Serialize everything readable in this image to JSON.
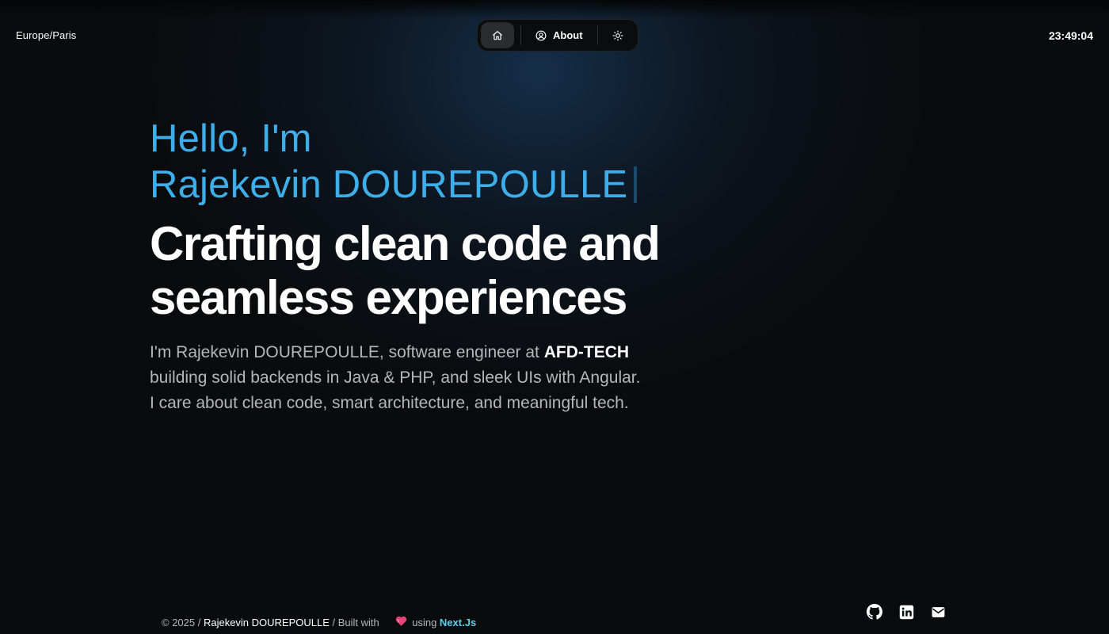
{
  "header": {
    "timezone": "Europe/Paris",
    "time": "23:49:04"
  },
  "nav": {
    "home_icon": "home-icon",
    "about_icon": "user-circle-icon",
    "about_label": "About",
    "theme_icon": "sun-icon"
  },
  "hero": {
    "greeting": "Hello, I'm",
    "name": "Rajekevin DOUREPOULLE",
    "headline_line1": "Crafting clean code and",
    "headline_line2": "seamless experiences",
    "intro_part1": "I'm Rajekevin DOUREPOULLE, software engineer at ",
    "intro_company": "AFD-TECH",
    "intro_line2": "building solid backends in Java & PHP, and sleek UIs with Angular.",
    "intro_line3": "I care about clean code, smart architecture, and meaningful tech."
  },
  "footer": {
    "copyright": "© 2025 / ",
    "author": "Rajekevin DOUREPOULLE",
    "built_with": " / Built with",
    "heart_icon": "heart-icon",
    "using": "using ",
    "tech": "Next.Js"
  },
  "socials": {
    "github_icon": "github-icon",
    "linkedin_icon": "linkedin-icon",
    "email_icon": "mail-icon"
  },
  "colors": {
    "accent": "#3daeea",
    "tech_link": "#5ed0e8",
    "background": "#0a0b0d",
    "text_muted": "#b4b6ba"
  }
}
